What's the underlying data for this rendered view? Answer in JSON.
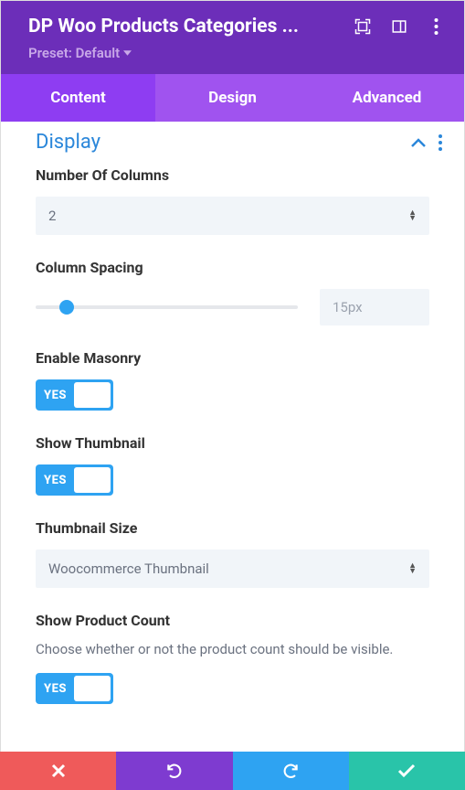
{
  "header": {
    "title": "DP Woo Products Categories ...",
    "preset_label": "Preset: Default"
  },
  "tabs": {
    "content": "Content",
    "design": "Design",
    "advanced": "Advanced"
  },
  "section": {
    "title": "Display"
  },
  "fields": {
    "columns_label": "Number Of Columns",
    "columns_value": "2",
    "spacing_label": "Column Spacing",
    "spacing_value": "15px",
    "masonry_label": "Enable Masonry",
    "masonry_toggle": "YES",
    "thumbnail_label": "Show Thumbnail",
    "thumbnail_toggle": "YES",
    "thumbsize_label": "Thumbnail Size",
    "thumbsize_value": "Woocommerce Thumbnail",
    "prodcount_label": "Show Product Count",
    "prodcount_help": "Choose whether or not the product count should be visible.",
    "prodcount_toggle": "YES"
  }
}
